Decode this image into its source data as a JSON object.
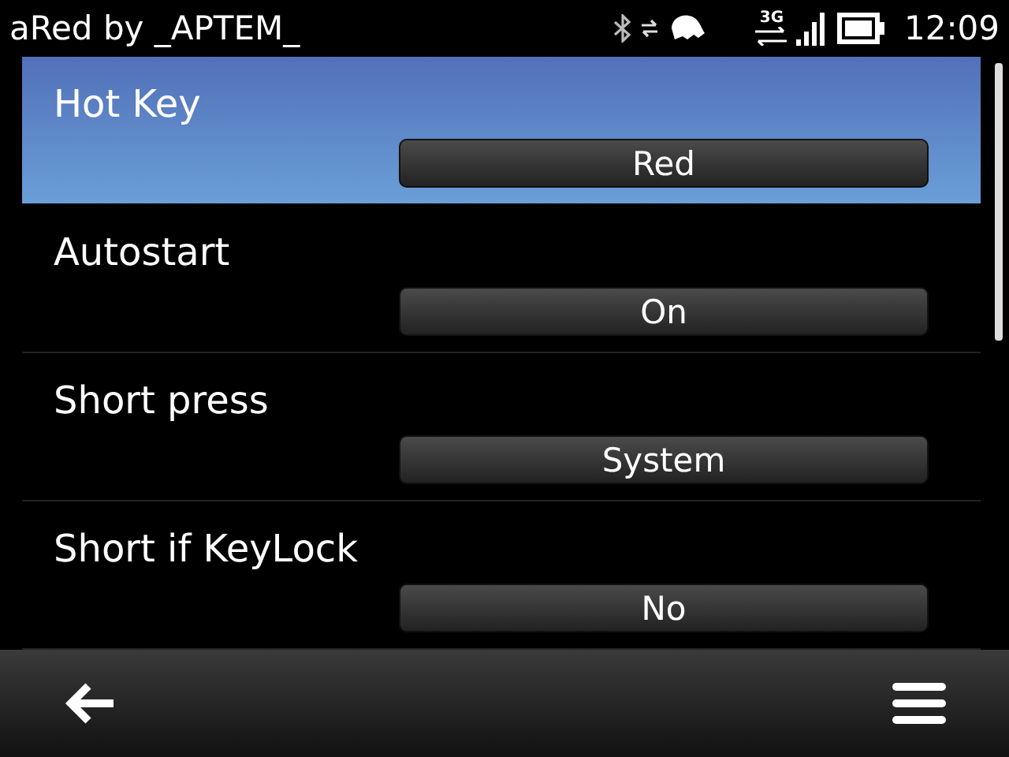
{
  "status_bar": {
    "title": "aRed by _APTEM_",
    "network": "3G",
    "time": "12:09"
  },
  "settings": [
    {
      "label": "Hot Key",
      "value": "Red",
      "selected": true
    },
    {
      "label": "Autostart",
      "value": "On",
      "selected": false
    },
    {
      "label": "Short press",
      "value": "System",
      "selected": false
    },
    {
      "label": "Short if KeyLock",
      "value": "No",
      "selected": false
    }
  ]
}
